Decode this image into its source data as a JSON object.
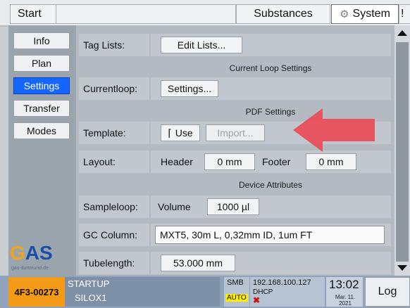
{
  "tabs": {
    "start": "Start",
    "substances": "Substances",
    "system": "System",
    "overflow": "!"
  },
  "nav": {
    "items": [
      {
        "label": "Info",
        "active": false
      },
      {
        "label": "Plan",
        "active": false
      },
      {
        "label": "Settings",
        "active": true
      },
      {
        "label": "Transfer",
        "active": false
      },
      {
        "label": "Modes",
        "active": false
      }
    ]
  },
  "logo": {
    "text_g": "G",
    "text_as": "AS",
    "sub": "gas-dortmund.de"
  },
  "settings": {
    "tag_lists": {
      "label": "Tag Lists:",
      "button": "Edit Lists..."
    },
    "section_current_loop": "Current Loop Settings",
    "currentloop": {
      "label": "Currentloop:",
      "button": "Settings..."
    },
    "section_pdf": "PDF Settings",
    "template": {
      "label": "Template:",
      "use_checkbox": "Use",
      "import_button": "Import..."
    },
    "layout": {
      "label": "Layout:",
      "header_label": "Header",
      "header_value": "0 mm",
      "footer_label": "Footer",
      "footer_value": "0 mm"
    },
    "section_device": "Device Attributes",
    "sampleloop": {
      "label": "Sampleloop:",
      "volume_label": "Volume",
      "volume_value": "1000 µl"
    },
    "gc_column": {
      "label": "GC Column:",
      "value": "MXT5, 30m L, 0,32mm ID, 1um FT"
    },
    "tubelength": {
      "label": "Tubelength:",
      "value": "53.000 mm"
    }
  },
  "status": {
    "device_id": "4F3-00273",
    "state_line1": "STARTUP",
    "state_line2": "SILOX1",
    "smb": "SMB",
    "auto": "AUTO",
    "ip": "192.168.100.127",
    "dhcp": "DHCP",
    "net_error": "✖",
    "time": "13:02",
    "date": "Mar. 11. 2021",
    "log_button": "Log"
  },
  "colors": {
    "active_nav": "#1565ff",
    "device_id_bg": "#f39a16",
    "arrow": "#ea4b57",
    "auto_badge": "#ffee00"
  }
}
